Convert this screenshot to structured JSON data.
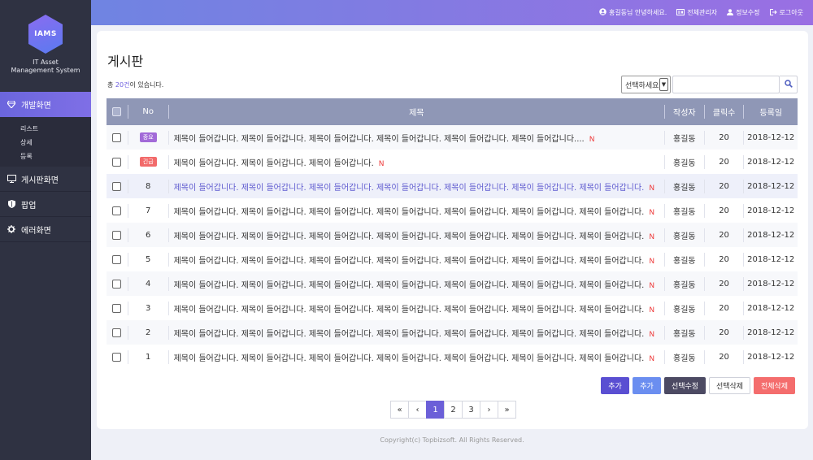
{
  "brand": {
    "logo": "IAMS",
    "system_line1": "IT Asset",
    "system_line2": "Management System"
  },
  "sidebar": {
    "items": [
      {
        "label": "개발화면",
        "icon": "diamond-icon",
        "active": true
      },
      {
        "label": "게시판화면",
        "icon": "monitor-icon"
      },
      {
        "label": "팝업",
        "icon": "shield-icon"
      },
      {
        "label": "에러화면",
        "icon": "gear-icon"
      }
    ],
    "submenu": [
      "리스트",
      "상세",
      "등록"
    ]
  },
  "topbar": {
    "greeting": "홍길동님 안녕하세요.",
    "admin": "전체관리자",
    "info": "정보수정",
    "logout": "로그아웃"
  },
  "page": {
    "title": "게시판",
    "count_prefix": "총 ",
    "count_num": "20건",
    "count_suffix": "이 있습니다."
  },
  "search": {
    "select_value": "선택하세요",
    "input_value": ""
  },
  "table": {
    "headers": {
      "no": "No",
      "title": "제목",
      "author": "작성자",
      "clicks": "클릭수",
      "date": "등록일"
    },
    "rows": [
      {
        "no": "",
        "badge": "중요",
        "badge_type": "important",
        "title": "제목이 들어갑니다. 제목이 들어갑니다. 제목이 들어갑니다. 제목이 들어갑니다. 제목이 들어갑니다. 제목이 들어갑니다....",
        "new": "N",
        "author": "홍길동",
        "clicks": "20",
        "date": "2018-12-12"
      },
      {
        "no": "",
        "badge": "긴급",
        "badge_type": "urgent",
        "title": "제목이 들어갑니다. 제목이 들어갑니다. 제목이 들어갑니다.",
        "new": "N",
        "author": "홍길동",
        "clicks": "20",
        "date": "2018-12-12"
      },
      {
        "no": "8",
        "badge": "",
        "title": "제목이 들어갑니다. 제목이 들어갑니다. 제목이 들어갑니다. 제목이 들어갑니다. 제목이 들어갑니다. 제목이 들어갑니다. 제목이 들어갑니다.",
        "new": "N",
        "author": "홍길동",
        "clicks": "20",
        "date": "2018-12-12",
        "highlight": true
      },
      {
        "no": "7",
        "badge": "",
        "title": "제목이 들어갑니다. 제목이 들어갑니다. 제목이 들어갑니다. 제목이 들어갑니다. 제목이 들어갑니다. 제목이 들어갑니다. 제목이 들어갑니다.",
        "new": "N",
        "author": "홍길동",
        "clicks": "20",
        "date": "2018-12-12"
      },
      {
        "no": "6",
        "badge": "",
        "title": "제목이 들어갑니다. 제목이 들어갑니다. 제목이 들어갑니다. 제목이 들어갑니다. 제목이 들어갑니다. 제목이 들어갑니다. 제목이 들어갑니다.",
        "new": "N",
        "author": "홍길동",
        "clicks": "20",
        "date": "2018-12-12"
      },
      {
        "no": "5",
        "badge": "",
        "title": "제목이 들어갑니다. 제목이 들어갑니다. 제목이 들어갑니다. 제목이 들어갑니다. 제목이 들어갑니다. 제목이 들어갑니다. 제목이 들어갑니다.",
        "new": "N",
        "author": "홍길동",
        "clicks": "20",
        "date": "2018-12-12"
      },
      {
        "no": "4",
        "badge": "",
        "title": "제목이 들어갑니다. 제목이 들어갑니다. 제목이 들어갑니다. 제목이 들어갑니다. 제목이 들어갑니다. 제목이 들어갑니다. 제목이 들어갑니다.",
        "new": "N",
        "author": "홍길동",
        "clicks": "20",
        "date": "2018-12-12"
      },
      {
        "no": "3",
        "badge": "",
        "title": "제목이 들어갑니다. 제목이 들어갑니다. 제목이 들어갑니다. 제목이 들어갑니다. 제목이 들어갑니다. 제목이 들어갑니다. 제목이 들어갑니다.",
        "new": "N",
        "author": "홍길동",
        "clicks": "20",
        "date": "2018-12-12"
      },
      {
        "no": "2",
        "badge": "",
        "title": "제목이 들어갑니다. 제목이 들어갑니다. 제목이 들어갑니다. 제목이 들어갑니다. 제목이 들어갑니다. 제목이 들어갑니다. 제목이 들어갑니다.",
        "new": "N",
        "author": "홍길동",
        "clicks": "20",
        "date": "2018-12-12"
      },
      {
        "no": "1",
        "badge": "",
        "title": "제목이 들어갑니다. 제목이 들어갑니다. 제목이 들어갑니다. 제목이 들어갑니다. 제목이 들어갑니다. 제목이 들어갑니다. 제목이 들어갑니다.",
        "new": "N",
        "author": "홍길동",
        "clicks": "20",
        "date": "2018-12-12"
      }
    ]
  },
  "buttons": {
    "add1": "추가",
    "add2": "추가",
    "edit_selected": "선택수정",
    "delete_selected": "선택삭제",
    "delete_all": "전체삭제"
  },
  "pagination": {
    "first": "«",
    "prev": "‹",
    "pages": [
      "1",
      "2",
      "3"
    ],
    "current": "1",
    "next": "›",
    "last": "»"
  },
  "footer": "Copyright(c) Topbizsoft. All Rights Reserved.",
  "colors": {
    "accent": "#6b5fd8",
    "sidebar": "#2f3242",
    "table_header": "#8f97b6",
    "new_mark": "#ee3b3b"
  }
}
